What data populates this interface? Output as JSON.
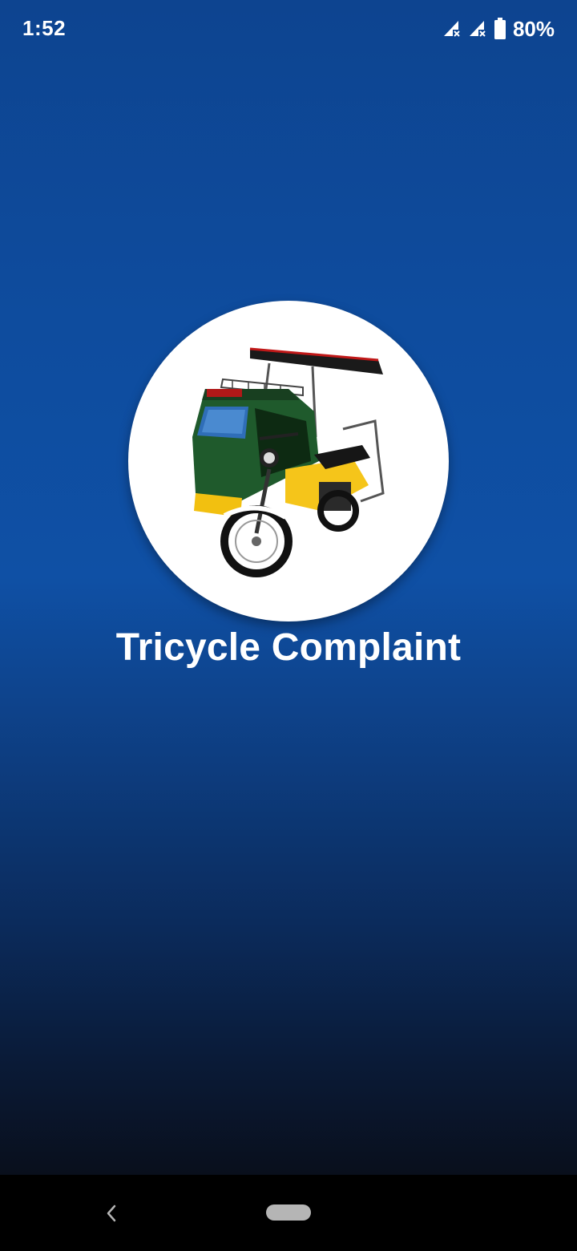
{
  "status_bar": {
    "time": "1:52",
    "battery_percent": "80%",
    "icons": [
      "signal-no-data-icon",
      "signal-no-data-icon",
      "battery-icon"
    ]
  },
  "splash": {
    "title": "Tricycle Complaint",
    "logo": "tricycle-logo"
  },
  "nav_bar": {
    "icons": [
      "back-icon",
      "home-pill-icon"
    ]
  },
  "colors": {
    "background_top": "#0d4490",
    "background_mid": "#0f50a5",
    "background_bottom": "#090f1c",
    "text": "#ffffff",
    "nav_bar": "#000000"
  }
}
